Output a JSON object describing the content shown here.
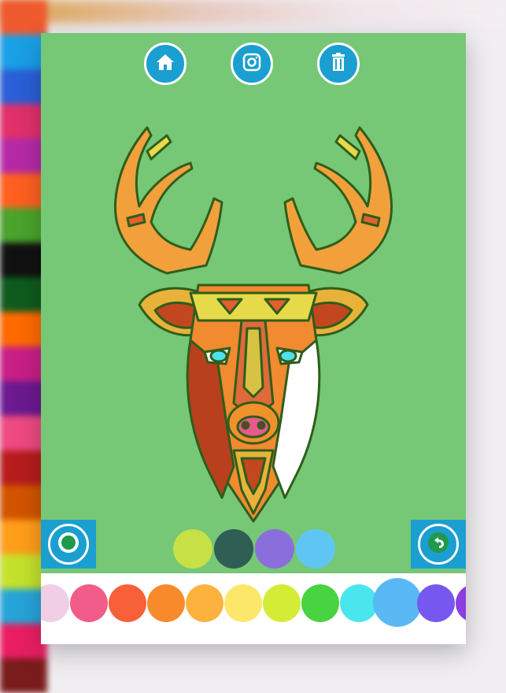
{
  "toolbar": {
    "home_icon": "home-icon",
    "camera_icon": "camera-icon",
    "trash_icon": "trash-icon"
  },
  "artwork": {
    "subject": "deer-head-mandala",
    "background_color": "#76c776"
  },
  "controls": {
    "brush_icon": "brush-size-icon",
    "undo_icon": "undo-icon"
  },
  "recent_colors": [
    "#c6e046",
    "#2f5e55",
    "#8a6fdc",
    "#5fc6f4"
  ],
  "palette_colors": [
    "#f0cfe6",
    "#f25c8a",
    "#f8603a",
    "#f98a2c",
    "#fdb23e",
    "#fde76a",
    "#d4ec35",
    "#48d340",
    "#4be5ee",
    "#5ab8f5",
    "#7658f0",
    "#8b3fe0"
  ],
  "selected_palette_index": 9,
  "colors": {
    "accent": "#1a9fd0",
    "canvas": "#76c776"
  }
}
